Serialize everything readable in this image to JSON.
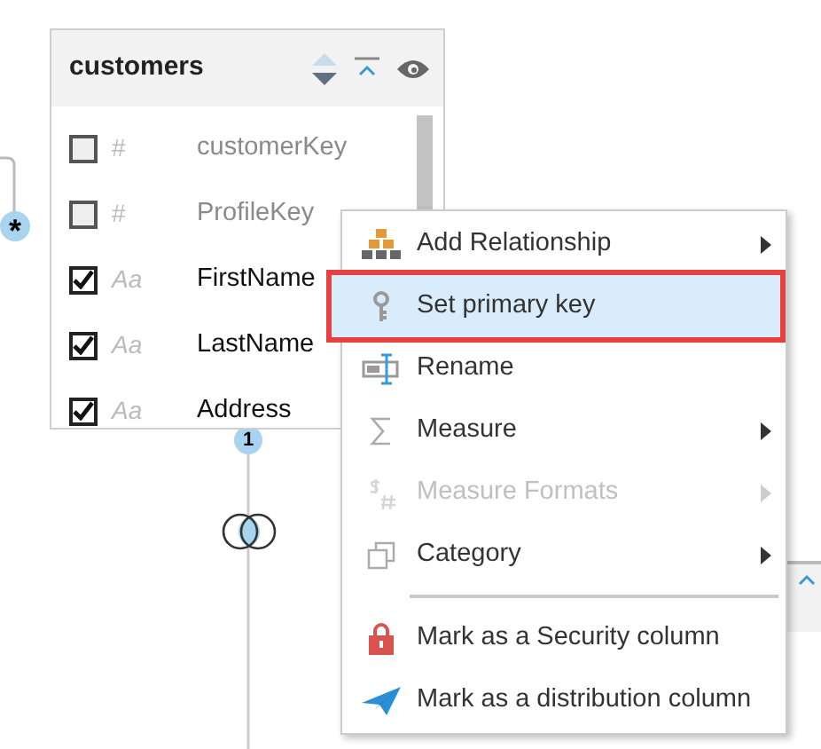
{
  "table": {
    "title": "customers",
    "fields": [
      {
        "name": "customerKey",
        "type_icon": "#",
        "checked": false
      },
      {
        "name": "ProfileKey",
        "type_icon": "#",
        "checked": false
      },
      {
        "name": "FirstName",
        "type_icon": "Aa",
        "checked": true
      },
      {
        "name": "LastName",
        "type_icon": "Aa",
        "checked": true
      },
      {
        "name": "Address",
        "type_icon": "Aa",
        "checked": true
      }
    ]
  },
  "connectors": [
    {
      "label": "*"
    },
    {
      "label": "1"
    }
  ],
  "context_menu": {
    "items": [
      {
        "kind": "item",
        "label": "Add Relationship",
        "submenu": true,
        "disabled": false,
        "selected": false
      },
      {
        "kind": "item",
        "label": "Set primary key",
        "submenu": false,
        "disabled": false,
        "selected": true
      },
      {
        "kind": "item",
        "label": "Rename",
        "submenu": false,
        "disabled": false,
        "selected": false
      },
      {
        "kind": "item",
        "label": "Measure",
        "submenu": true,
        "disabled": false,
        "selected": false
      },
      {
        "kind": "item",
        "label": "Measure Formats",
        "submenu": true,
        "disabled": true,
        "selected": false
      },
      {
        "kind": "item",
        "label": "Category",
        "submenu": true,
        "disabled": false,
        "selected": false
      },
      {
        "kind": "separator"
      },
      {
        "kind": "item",
        "label": "Mark as a Security column",
        "submenu": false,
        "disabled": false,
        "selected": false
      },
      {
        "kind": "item",
        "label": "Mark as a distribution column",
        "submenu": false,
        "disabled": false,
        "selected": false
      }
    ]
  }
}
